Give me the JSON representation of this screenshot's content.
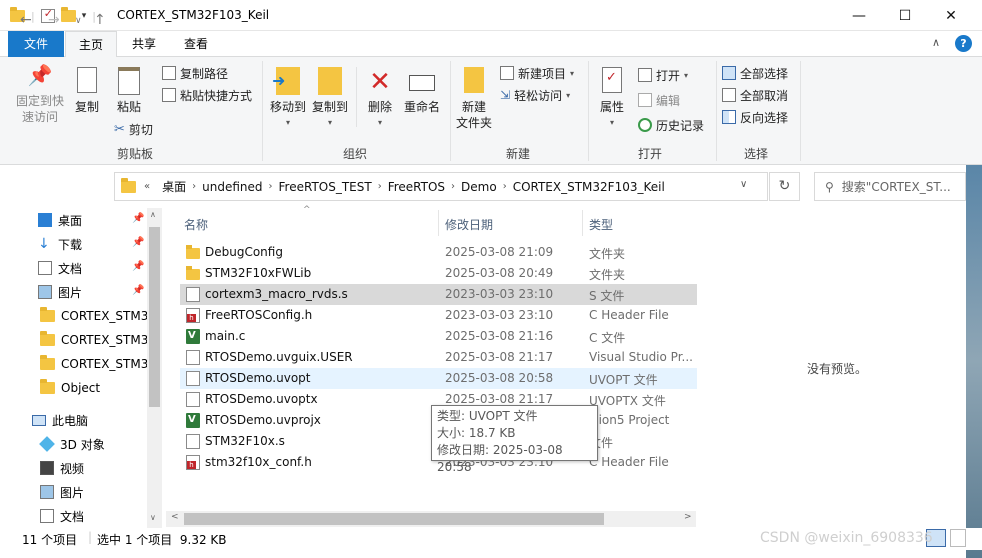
{
  "window": {
    "title": "CORTEX_STM32F103_Keil",
    "min": "—",
    "max": "☐",
    "close": "✕"
  },
  "tabs": {
    "file": "文件",
    "home": "主页",
    "share": "共享",
    "view": "查看"
  },
  "ribbon": {
    "pin_quick": "固定到快速访问",
    "copy": "复制",
    "paste": "粘贴",
    "copy_path": "复制路径",
    "paste_shortcut": "粘贴快捷方式",
    "cut": "剪切",
    "group_clipboard": "剪贴板",
    "move_to": "移动到",
    "copy_to": "复制到",
    "delete": "删除",
    "rename": "重命名",
    "group_organize": "组织",
    "new_folder": "新建\n文件夹",
    "new_item": "新建项目",
    "easy_access": "轻松访问",
    "group_new": "新建",
    "properties": "属性",
    "open": "打开",
    "edit": "编辑",
    "history": "历史记录",
    "group_open": "打开",
    "select_all": "全部选择",
    "select_none": "全部取消",
    "invert_selection": "反向选择",
    "group_select": "选择"
  },
  "address": {
    "prefix": "«",
    "crumbs": [
      "桌面",
      "undefined",
      "FreeRTOS_TEST",
      "FreeRTOS",
      "Demo",
      "CORTEX_STM32F103_Keil"
    ],
    "search_placeholder": "搜索\"CORTEX_ST..."
  },
  "nav": {
    "quick": [
      {
        "label": "桌面",
        "icon": "desktop-icon"
      },
      {
        "label": "下载",
        "icon": "download-icon"
      },
      {
        "label": "文档",
        "icon": "documents-icon"
      },
      {
        "label": "图片",
        "icon": "pictures-icon"
      },
      {
        "label": "CORTEX_STM3",
        "icon": "folder-icon"
      },
      {
        "label": "CORTEX_STM3",
        "icon": "folder-icon"
      },
      {
        "label": "CORTEX_STM3",
        "icon": "folder-icon"
      },
      {
        "label": "Object",
        "icon": "folder-icon"
      }
    ],
    "this_pc": "此电脑",
    "pc_items": [
      {
        "label": "3D 对象",
        "icon": "3d-objects-icon"
      },
      {
        "label": "视频",
        "icon": "videos-icon"
      },
      {
        "label": "图片",
        "icon": "pictures-icon"
      },
      {
        "label": "文档",
        "icon": "documents-icon"
      }
    ]
  },
  "columns": {
    "name": "名称",
    "date": "修改日期",
    "type": "类型"
  },
  "files": [
    {
      "name": "DebugConfig",
      "date": "2025-03-08 21:09",
      "type": "文件夹",
      "icon": "folder"
    },
    {
      "name": "STM32F10xFWLib",
      "date": "2025-03-08 20:49",
      "type": "文件夹",
      "icon": "folder"
    },
    {
      "name": "cortexm3_macro_rvds.s",
      "date": "2023-03-03 23:10",
      "type": "S 文件",
      "icon": "doc"
    },
    {
      "name": "FreeRTOSConfig.h",
      "date": "2023-03-03 23:10",
      "type": "C Header File",
      "icon": "h"
    },
    {
      "name": "main.c",
      "date": "2025-03-08 21:16",
      "type": "C 文件",
      "icon": "c"
    },
    {
      "name": "RTOSDemo.uvguix.USER",
      "date": "2025-03-08 21:17",
      "type": "Visual Studio Pr...",
      "icon": "doc"
    },
    {
      "name": "RTOSDemo.uvopt",
      "date": "2025-03-08 20:58",
      "type": "UVOPT 文件",
      "icon": "doc"
    },
    {
      "name": "RTOSDemo.uvoptx",
      "date": "2025-03-08 21:17",
      "type": "UVOPTX 文件",
      "icon": "doc"
    },
    {
      "name": "RTOSDemo.uvprojx",
      "date": "",
      "type": "ision5 Project",
      "icon": "c"
    },
    {
      "name": "STM32F10x.s",
      "date": "",
      "type": "文件",
      "icon": "doc"
    },
    {
      "name": "stm32f10x_conf.h",
      "date": "2023-03-03 23:10",
      "type": "C Header File",
      "icon": "h"
    }
  ],
  "tooltip": {
    "type": "类型: UVOPT 文件",
    "size": "大小: 18.7 KB",
    "modified": "修改日期: 2025-03-08 20:58"
  },
  "preview": {
    "text": "没有预览。"
  },
  "status": {
    "count": "11 个项目",
    "selection": "选中 1 个项目  9.32 KB"
  },
  "watermark": "CSDN @weixin_6908336"
}
